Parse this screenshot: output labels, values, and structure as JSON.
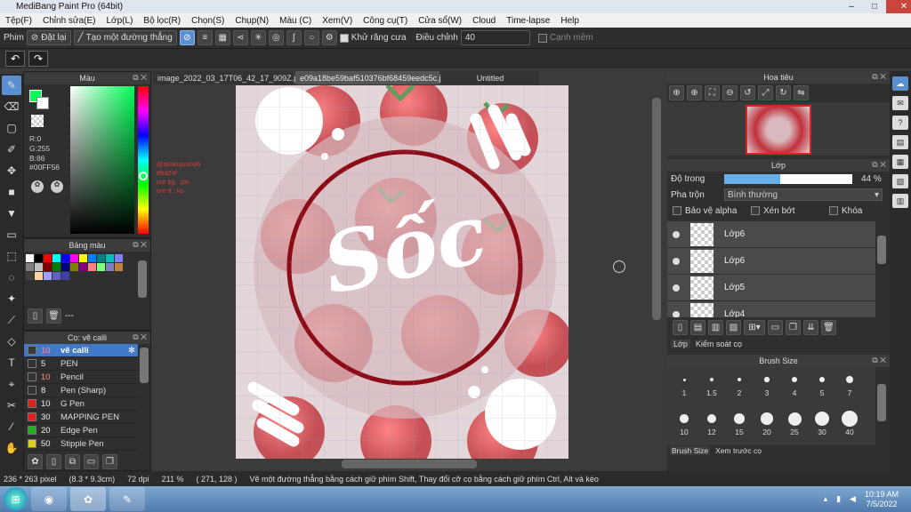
{
  "app": {
    "title": "MediBang Paint Pro (64bit)",
    "min": "–",
    "max": "□",
    "close": "✕"
  },
  "menu": [
    "Tệp(F)",
    "Chỉnh sửa(E)",
    "Lớp(L)",
    "Bộ lọc(R)",
    "Chọn(S)",
    "Chụp(N)",
    "Màu (C)",
    "Xem(V)",
    "Công cụ(T)",
    "Cửa sổ(W)",
    "Cloud",
    "Time-lapse",
    "Help"
  ],
  "options": {
    "label": "Phim",
    "reset": "Đặt lại",
    "create_line": "Tạo một đường thẳng",
    "antialias": "Khử răng cưa",
    "adjust": "Điều chỉnh",
    "adjust_value": "40",
    "smooth": "Cạnh mềm"
  },
  "color": {
    "title": "Màu",
    "r": "R:0",
    "g": "G:255",
    "b": "B:86",
    "hex": "#00FF56",
    "accent": "#00ff56"
  },
  "palette": {
    "title": "Bảng màu",
    "footer": "---"
  },
  "brushes": {
    "title": "Cọ: vẽ calli",
    "items": [
      {
        "size": "10",
        "name": "vẽ calli",
        "color": "#3a3a3a",
        "selected": true
      },
      {
        "size": "5",
        "name": "PEN",
        "color": "#333333"
      },
      {
        "size": "10",
        "name": "Pencil",
        "color": "#333333"
      },
      {
        "size": "8",
        "name": "Pen (Sharp)",
        "color": "#333333"
      },
      {
        "size": "10",
        "name": "G Pen",
        "color": "#e02020"
      },
      {
        "size": "30",
        "name": "MAPPING PEN",
        "color": "#e02020"
      },
      {
        "size": "20",
        "name": "Edge Pen",
        "color": "#20b020"
      },
      {
        "size": "50",
        "name": "Stipple Pen",
        "color": "#e0d020"
      }
    ]
  },
  "tabs": [
    "image_2022_03_17T06_42_17_909Z.png",
    "e09a18be59baf510376bf68459eedc5c.jpg",
    "Untitled"
  ],
  "canvas": {
    "notes": [
      "@quanquan86",
      "#bd24f",
      "cre bg : pin",
      "cre tt : ku"
    ],
    "word": "Sốc"
  },
  "navigator": {
    "title": "Hoa tiêu"
  },
  "layers": {
    "title": "Lớp",
    "opacity_label": "Độ trong",
    "opacity_value": "44 %",
    "opacity_fraction": 0.44,
    "blend_label": "Pha trộn",
    "blend_value": "Bình thường",
    "protect_alpha": "Bảo vệ alpha",
    "clip": "Xén bớt",
    "lock": "Khóa",
    "items": [
      "Lớp6",
      "Lớp6",
      "Lớp5",
      "Lớp4"
    ],
    "tab_layer": "Lớp",
    "tab_check": "Kiểm soát cọ"
  },
  "brushsize": {
    "title": "Brush Size",
    "sizes": [
      "1",
      "1.5",
      "2",
      "3",
      "4",
      "5",
      "7",
      "10",
      "12",
      "15",
      "20",
      "25",
      "30",
      "40"
    ],
    "tab1": "Brush Size",
    "tab2": "Xem trước cọ"
  },
  "status": {
    "size": "236 * 263 pixel",
    "dim": "(8.3 * 9.3cm)",
    "dpi": "72 dpi",
    "zoom": "211 %",
    "coord": "( 271, 128 )",
    "hint": "Vẽ một đường thẳng bằng cách giữ phím Shift, Thay đổi cỡ cọ bằng cách giữ phím Ctrl, Alt và kéo"
  },
  "taskbar": {
    "time": "10:19 AM",
    "date": "7/5/2022"
  }
}
